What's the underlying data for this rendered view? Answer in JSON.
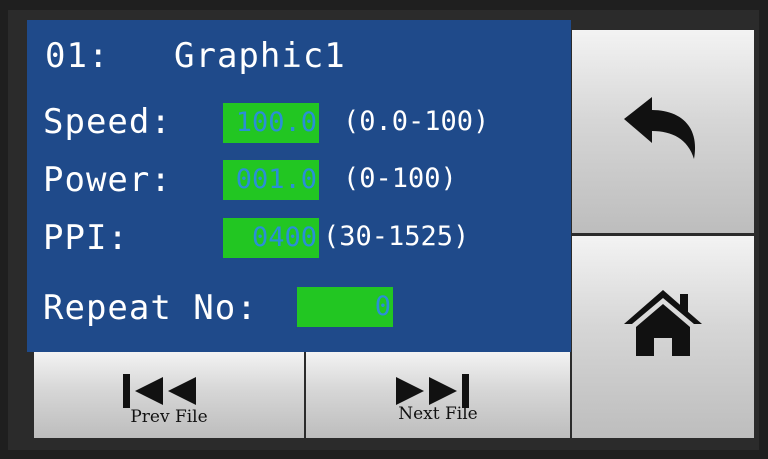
{
  "header": {
    "number": "01:",
    "file_name": "Graphic1"
  },
  "fields": {
    "speed": {
      "label": "Speed:",
      "value": "100.0",
      "range": "(0.0-100)"
    },
    "power": {
      "label": "Power:",
      "value": "001.0",
      "range": "(0-100)"
    },
    "ppi": {
      "label": "PPI:",
      "value": "0400",
      "range": "(30-1525)"
    },
    "repeat": {
      "label": "Repeat No:",
      "value": "0"
    }
  },
  "nav": {
    "prev_label": "Prev File",
    "next_label": "Next File"
  },
  "side": {
    "back_icon": "back-arrow-icon",
    "home_icon": "home-icon"
  },
  "colors": {
    "panel": "#1f4a8a",
    "value_bg": "#22c622",
    "value_text": "#2a8fd6",
    "button": "#d6d6d6"
  }
}
